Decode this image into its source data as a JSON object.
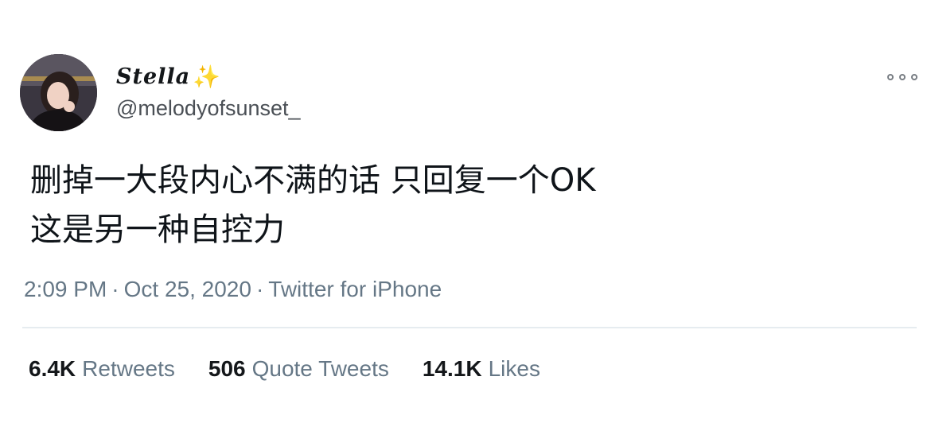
{
  "author": {
    "display_name": "Stella",
    "sparkle": "✨",
    "handle": "@melodyofsunset_"
  },
  "tweet": {
    "text": "删掉一大段内心不满的话 只回复一个OK\n这是另一种自控力"
  },
  "meta": {
    "time": "2:09 PM",
    "separator": "·",
    "date": "Oct 25, 2020",
    "source": "Twitter for iPhone"
  },
  "stats": [
    {
      "count": "6.4K",
      "label": "Retweets"
    },
    {
      "count": "506",
      "label": "Quote Tweets"
    },
    {
      "count": "14.1K",
      "label": "Likes"
    }
  ],
  "colors": {
    "text_primary": "#14171a",
    "text_secondary": "#657786",
    "sparkle": "#f5b82e",
    "divider": "#e6ecf0"
  },
  "icons": {
    "more": "more-horizontal-icon",
    "sparkle": "sparkle-icon"
  }
}
